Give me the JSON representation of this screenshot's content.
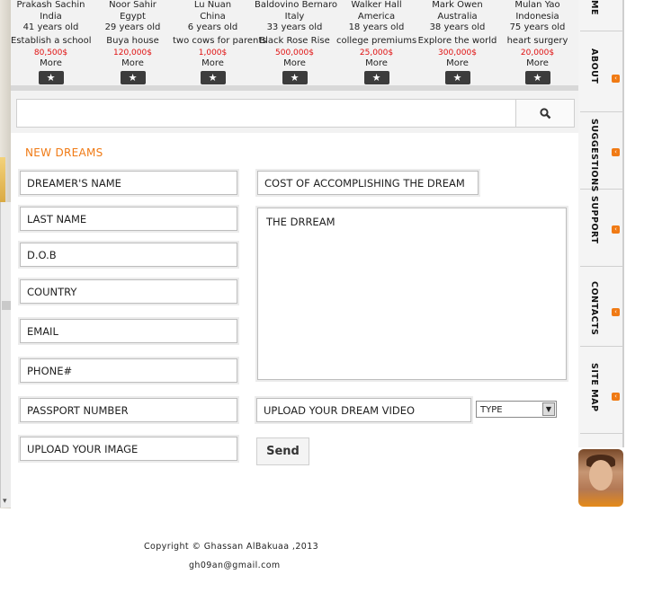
{
  "dreamers": [
    {
      "name": "Prakash Sachin",
      "country": "India",
      "age": "41 years old",
      "wish": "Establish a school",
      "cost": "80,500$",
      "more": "More"
    },
    {
      "name": "Noor  Sahir",
      "country": "Egypt",
      "age": "29 years old",
      "wish": "Buya house",
      "cost": "120,000$",
      "more": "More"
    },
    {
      "name": "Lu  Nuan",
      "country": "China",
      "age": "6 years old",
      "wish": "two cows for parents",
      "cost": "1,000$",
      "more": "More"
    },
    {
      "name": "Baldovino  Bernaro",
      "country": "Italy",
      "age": "33 years old",
      "wish": "Black Rose Rise",
      "cost": "500,000$",
      "more": "More"
    },
    {
      "name": "Walker  Hall",
      "country": "America",
      "age": "18 years old",
      "wish": "college premiums",
      "cost": "25,000$",
      "more": "More"
    },
    {
      "name": "Mark Owen",
      "country": "Australia",
      "age": "38 years old",
      "wish": "Explore the world",
      "cost": "300,000$",
      "more": "More"
    },
    {
      "name": "Mulan Yao",
      "country": "Indonesia",
      "age": "75 years old",
      "wish": "heart surgery",
      "cost": "20,000$",
      "more": "More"
    }
  ],
  "search": {
    "placeholder": "",
    "icon": "search-icon"
  },
  "form": {
    "heading": "NEW DREAMS",
    "dreamer_name": "DREAMER'S NAME",
    "last_name": "LAST NAME",
    "dob": "D.O.B",
    "country": "COUNTRY",
    "email": "EMAIL",
    "phone": "PHONE#",
    "passport": "PASSPORT NUMBER",
    "upload_image": "UPLOAD YOUR IMAGE",
    "cost": "COST OF ACCOMPLISHING THE DREAM",
    "dream": "THE DRREAM",
    "upload_video": "UPLOAD YOUR DREAM VIDEO",
    "type_select": "TYPE",
    "send": "Send"
  },
  "sidebar": {
    "tabs": [
      {
        "label": "ME"
      },
      {
        "label": "ABOUT"
      },
      {
        "label": "SUGGESTIONS"
      },
      {
        "label": "SUPPORT"
      },
      {
        "label": "CONTACTS"
      },
      {
        "label": "SITE MAP"
      }
    ]
  },
  "footer": {
    "copyright": "Copyright © Ghassan AlBakuaa ,2013",
    "email": "gh09an@gmail.com"
  },
  "colors": {
    "accent": "#f07a14",
    "cost_red": "#e01010"
  }
}
